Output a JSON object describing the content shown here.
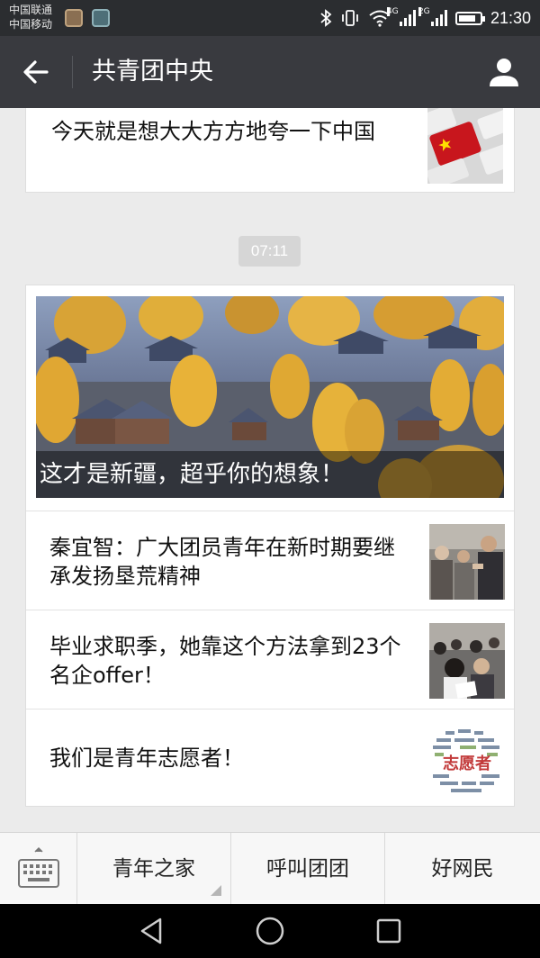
{
  "status_bar": {
    "carrier_1": "中国联通",
    "carrier_2": "中国移动",
    "network_1": "4G",
    "network_2": "2G",
    "time": "21:30",
    "battery_level": 0.8,
    "icons": [
      "bluetooth-icon",
      "vibrate-icon",
      "wifi-icon",
      "signal-icon",
      "battery-icon"
    ]
  },
  "header": {
    "title": "共青团中央",
    "back_icon": "arrow-left-icon",
    "profile_icon": "person-icon"
  },
  "feed": {
    "top_card": {
      "title": "今天就是想大大方方地夸一下中国",
      "thumbnail": "keyboard-china-flag-image"
    },
    "timestamp": "07:11",
    "article_group": {
      "lead": {
        "title": "这才是新疆，超乎你的想象！",
        "image": "autumn-village-landscape-image"
      },
      "items": [
        {
          "title": "秦宜智：广大团员青年在新时期要继承发扬垦荒精神",
          "thumbnail": "meeting-photo-image"
        },
        {
          "title": "毕业求职季，她靠这个方法拿到23个名企offer！",
          "thumbnail": "job-fair-photo-image"
        },
        {
          "title": "我们是青年志愿者！",
          "thumbnail": "volunteer-word-cloud-image",
          "thumbnail_text": "志愿者"
        }
      ]
    }
  },
  "menu": {
    "keyboard_icon": "keyboard-icon",
    "items": [
      {
        "label": "青年之家",
        "has_submenu": true
      },
      {
        "label": "呼叫团团",
        "has_submenu": false
      },
      {
        "label": "好网民",
        "has_submenu": false
      }
    ]
  },
  "nav_bar": {
    "icons": [
      "back-triangle-icon",
      "home-circle-icon",
      "recents-square-icon"
    ]
  },
  "colors": {
    "status_bar": "#2b2d30",
    "title_bar": "#393a3f",
    "background": "#ebebeb",
    "card": "#ffffff",
    "menu_bar": "#f7f7f7"
  }
}
